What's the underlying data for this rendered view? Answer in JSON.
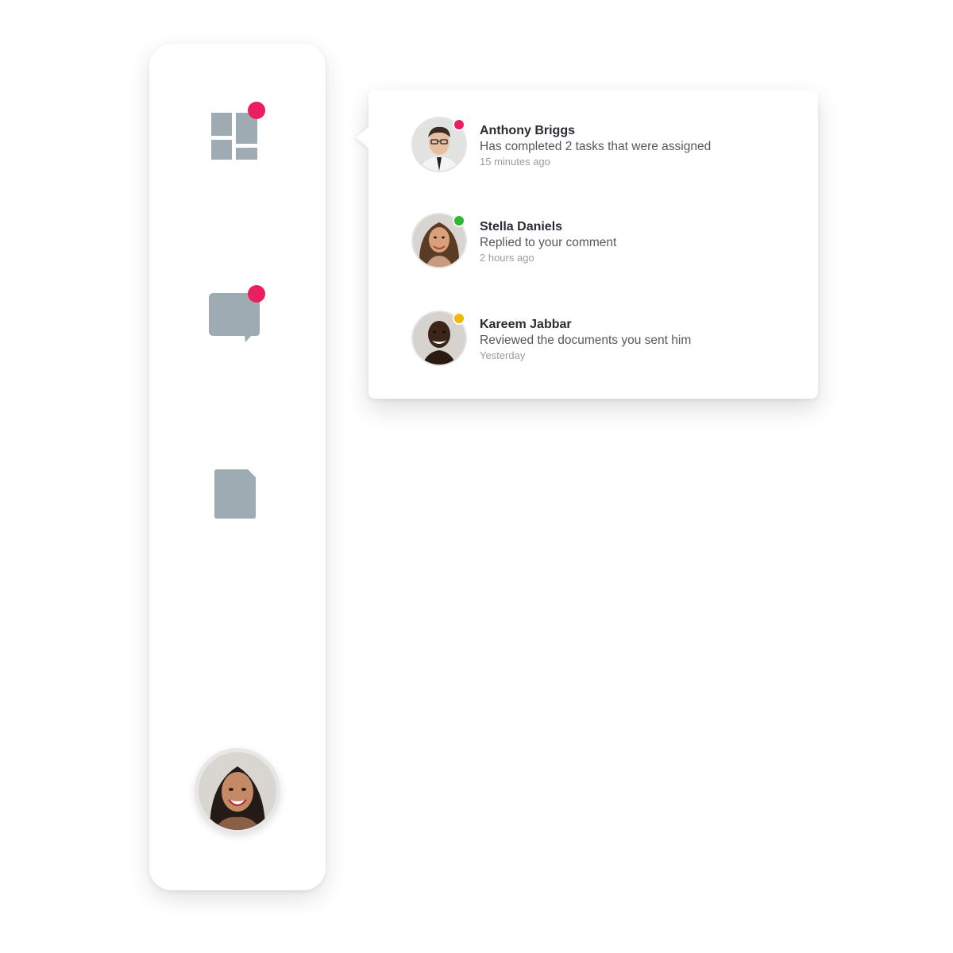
{
  "colors": {
    "icon_gray": "#9eabb2",
    "alert_dot": "#ea1f5f",
    "status_online": "#2fb634",
    "status_away": "#f2b705",
    "status_busy": "#ea1f5f"
  },
  "sidebar": {
    "items": [
      {
        "icon": "dashboard-icon",
        "has_badge": true
      },
      {
        "icon": "chat-bubble-icon",
        "has_badge": true
      },
      {
        "icon": "document-icon",
        "has_badge": false
      }
    ],
    "profile": {
      "icon": "user-avatar"
    }
  },
  "notifications": [
    {
      "name": "Anthony Briggs",
      "message": "Has completed 2 tasks that were assigned",
      "time": "15 minutes ago",
      "status_color": "#ea1f5f"
    },
    {
      "name": "Stella Daniels",
      "message": "Replied to your comment",
      "time": "2 hours ago",
      "status_color": "#2fb634"
    },
    {
      "name": "Kareem Jabbar",
      "message": "Reviewed the documents you sent him",
      "time": "Yesterday",
      "status_color": "#f2b705"
    }
  ]
}
